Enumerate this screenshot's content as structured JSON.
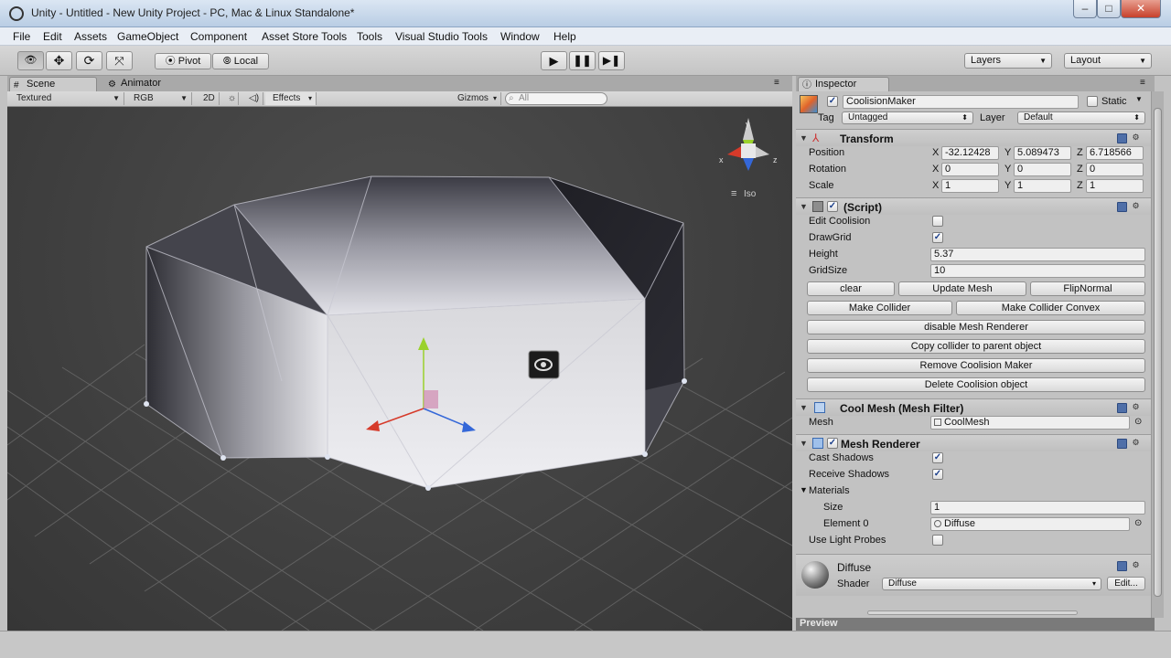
{
  "window": {
    "title": "Unity - Untitled - New Unity Project - PC, Mac & Linux Standalone*",
    "controls": {
      "minimize": "–",
      "maximize": "□",
      "close": "✕"
    }
  },
  "menu": [
    "File",
    "Edit",
    "Assets",
    "GameObject",
    "Component",
    "Asset Store Tools",
    "Tools",
    "Visual Studio Tools",
    "Window",
    "Help"
  ],
  "toolbar": {
    "pivot": "Pivot",
    "local": "Local",
    "layers": "Layers",
    "layout": "Layout"
  },
  "scene": {
    "tab_scene": "Scene",
    "tab_animator": "Animator",
    "shading": "Textured",
    "render": "RGB",
    "mode_2d": "2D",
    "effects": "Effects",
    "gizmos": "Gizmos",
    "search_placeholder": "All",
    "gizmo_axis_x": "x",
    "gizmo_axis_y": "y",
    "gizmo_axis_z": "z",
    "iso": "Iso"
  },
  "inspector": {
    "tab": "Inspector",
    "object_name": "CoolisionMaker",
    "static_label": "Static",
    "tag_label": "Tag",
    "tag_value": "Untagged",
    "layer_label": "Layer",
    "layer_value": "Default",
    "transform": {
      "title": "Transform",
      "rows": [
        {
          "label": "Position",
          "x": "-32.12428",
          "y": "5.089473",
          "z": "6.718566"
        },
        {
          "label": "Rotation",
          "x": "0",
          "y": "0",
          "z": "0"
        },
        {
          "label": "Scale",
          "x": "1",
          "y": "1",
          "z": "1"
        }
      ],
      "axis_x": "X",
      "axis_y": "Y",
      "axis_z": "Z"
    },
    "script": {
      "title": "(Script)",
      "edit_coolision": "Edit Coolision",
      "draw_grid": "DrawGrid",
      "height_label": "Height",
      "height_value": "5.37",
      "grid_size_label": "GridSize",
      "grid_size_value": "10",
      "btn_clear": "clear",
      "btn_update_mesh": "Update Mesh",
      "btn_flip_normal": "FlipNormal",
      "btn_make_collider": "Make Collider",
      "btn_make_collider_convex": "Make Collider Convex",
      "btn_disable_mesh_renderer": "disable Mesh Renderer",
      "btn_copy_collider": "Copy collider to parent object",
      "btn_remove_maker": "Remove Coolision Maker",
      "btn_delete_object": "Delete Coolision object"
    },
    "mesh_filter": {
      "title": "Cool Mesh (Mesh Filter)",
      "mesh_label": "Mesh",
      "mesh_value": "CoolMesh"
    },
    "mesh_renderer": {
      "title": "Mesh Renderer",
      "cast_shadows": "Cast Shadows",
      "receive_shadows": "Receive Shadows",
      "materials": "Materials",
      "size_label": "Size",
      "size_value": "1",
      "element0_label": "Element 0",
      "element0_value": "Diffuse",
      "light_probes": "Use Light Probes"
    },
    "material": {
      "name": "Diffuse",
      "shader_label": "Shader",
      "shader_value": "Diffuse",
      "edit": "Edit..."
    },
    "preview": "Preview"
  },
  "colors": {
    "gizmo_x": "#d63a2a",
    "gizmo_y": "#9ad12c",
    "gizmo_z": "#3467d8"
  }
}
